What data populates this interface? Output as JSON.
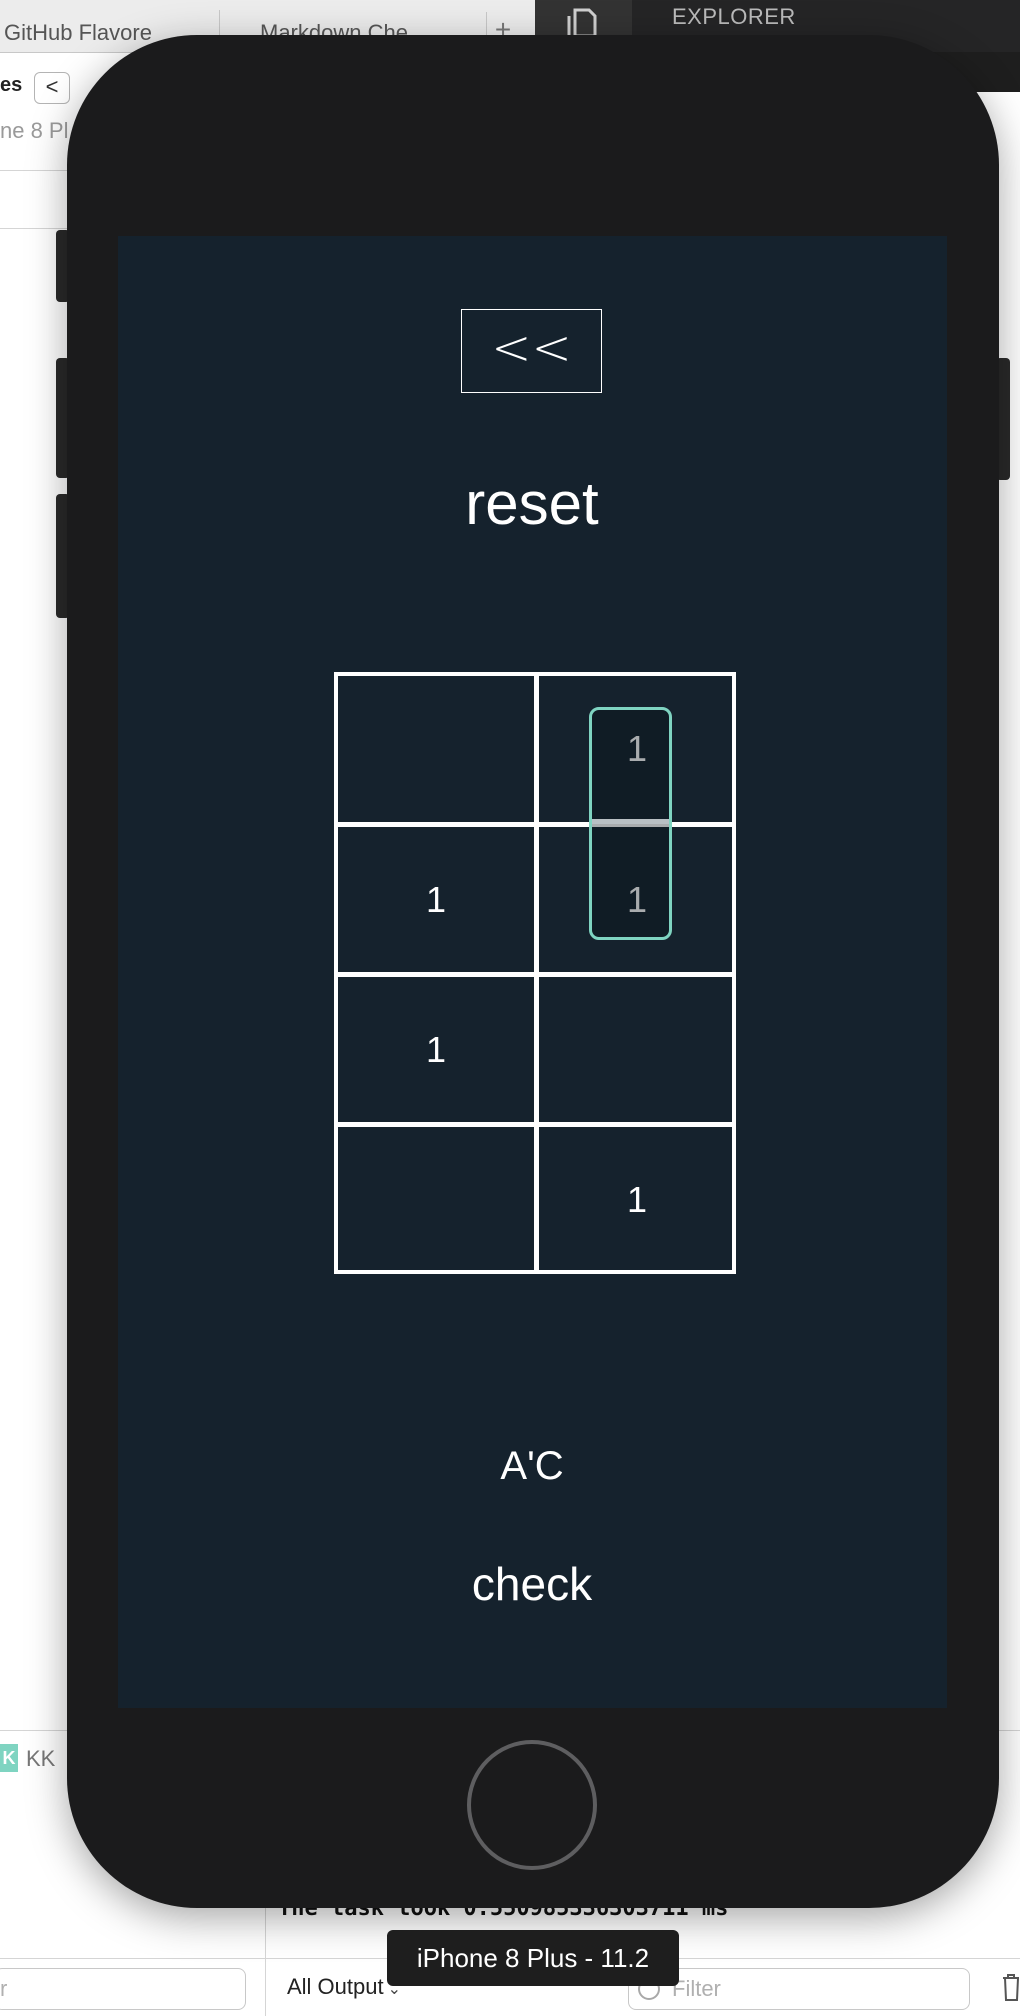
{
  "editor_tabs": {
    "tab1_label": "GitHub Flavore",
    "tab2_label": "Markdown Che",
    "add_label": "+"
  },
  "navigator": {
    "label": "es",
    "back_label": "<",
    "device_label": "ne 8 Pl"
  },
  "vscode": {
    "explorer_label": "EXPLORER"
  },
  "debug_bar": {
    "badge_label": "K",
    "target_label": "KK"
  },
  "console": {
    "output_line": "The task took 0.550985336303711 ms",
    "filter_left_placeholder": "r",
    "output_selector_label": "All Output",
    "filter_right_placeholder": "Filter"
  },
  "simulator": {
    "device_tooltip": "iPhone 8 Plus - 11.2"
  },
  "app": {
    "back_label": "<<",
    "reset_label": "reset",
    "expression": "A'C",
    "check_label": "check",
    "kmap": {
      "rows": [
        [
          "",
          "1"
        ],
        [
          "1",
          "1"
        ],
        [
          "1",
          ""
        ],
        [
          "",
          "1"
        ]
      ]
    },
    "colors": {
      "background": "#15222d",
      "group_outline": "#7fd4c1",
      "grid_lines": "#ffffff"
    }
  }
}
